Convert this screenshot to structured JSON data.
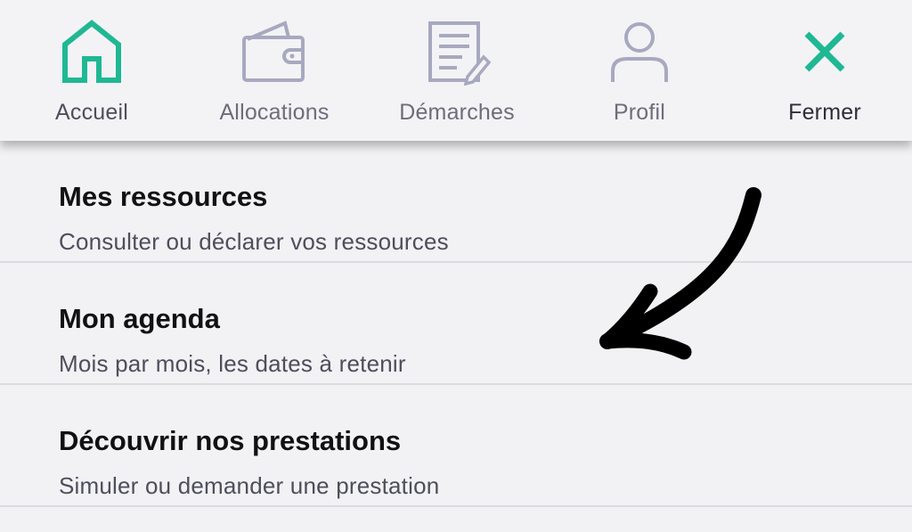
{
  "nav": {
    "items": [
      {
        "label": "Accueil",
        "icon": "home-icon",
        "color": "#1fb893",
        "active": true
      },
      {
        "label": "Allocations",
        "icon": "wallet-icon",
        "color": "#a8a8c0"
      },
      {
        "label": "Démarches",
        "icon": "document-edit-icon",
        "color": "#a8a8c0"
      },
      {
        "label": "Profil",
        "icon": "user-icon",
        "color": "#a8a8c0"
      },
      {
        "label": "Fermer",
        "icon": "close-icon",
        "color": "#1fb893"
      }
    ]
  },
  "menu": {
    "items": [
      {
        "title": "Mes ressources",
        "subtitle": "Consulter ou déclarer vos ressources"
      },
      {
        "title": "Mon agenda",
        "subtitle": "Mois par mois, les dates à retenir"
      },
      {
        "title": "Découvrir nos prestations",
        "subtitle": "Simuler ou demander une prestation"
      }
    ]
  },
  "annotation": {
    "icon": "hand-drawn-arrow-icon",
    "color": "#000000"
  }
}
